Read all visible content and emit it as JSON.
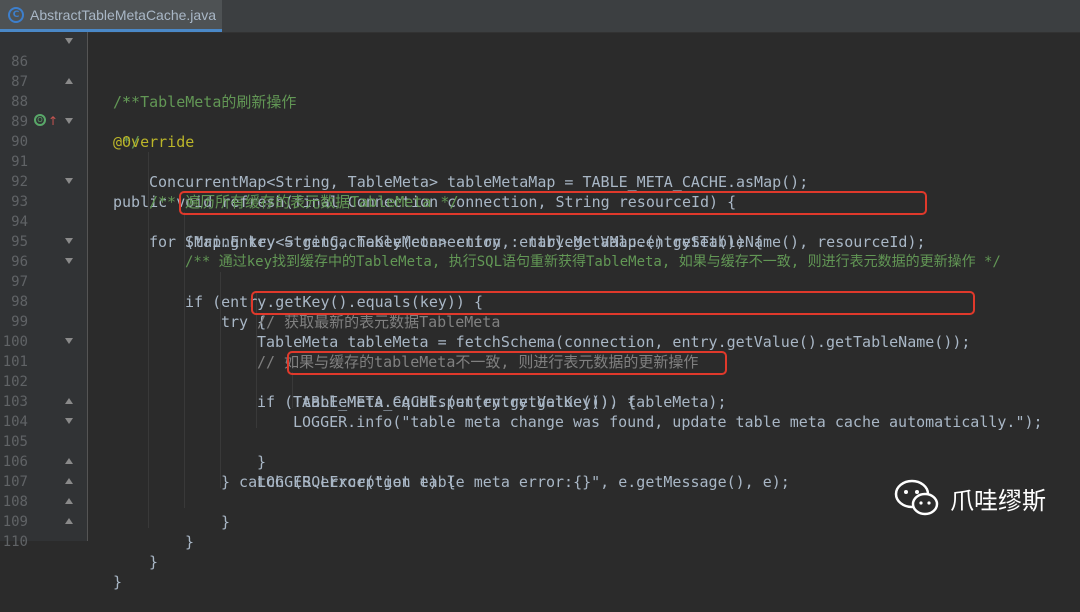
{
  "tab": {
    "label": "AbstractTableMetaCache.java",
    "icon": "java-class-icon"
  },
  "lines": [
    {
      "n": "86",
      "c": "/**"
    },
    {
      "n": "87",
      "c": " * TableMeta的刷新操作"
    },
    {
      "n": "88",
      "c": " */"
    },
    {
      "n": "89",
      "c": "@Override"
    },
    {
      "n": "90",
      "c": "public void refresh(final Connection connection, String resourceId) {"
    },
    {
      "n": "91",
      "c": "ConcurrentMap<String, TableMeta> tableMetaMap = TABLE_META_CACHE.asMap();"
    },
    {
      "n": "92",
      "c": "/** 遍历所有缓存的表元数据TableMeta */"
    },
    {
      "n": "93",
      "c": "for (Map.Entry<String, TableMeta> entry : tableMetaMap.entrySet()) {"
    },
    {
      "n": "94",
      "c": "String key = getCacheKey(connection, entry.getValue().getTableName(), resourceId);"
    },
    {
      "n": "95",
      "c": "/** 通过key找到缓存中的TableMeta, 执行SQL语句重新获得TableMeta, 如果与缓存不一致, 则进行表元数据的更新操作 */"
    },
    {
      "n": "96",
      "c": "if (entry.getKey().equals(key)) {"
    },
    {
      "n": "97",
      "c": "try {"
    },
    {
      "n": "98",
      "c": "// 获取最新的表元数据TableMeta"
    },
    {
      "n": "99",
      "c": "TableMeta tableMeta = fetchSchema(connection, entry.getValue().getTableName());"
    },
    {
      "n": "100",
      "c": "// 如果与缓存的tableMeta不一致, 则进行表元数据的更新操作"
    },
    {
      "n": "101",
      "c": "if (!tableMeta.equals(entry.getValue())) {"
    },
    {
      "n": "102",
      "c": "TABLE_META_CACHE.put(entry.getKey(), tableMeta);"
    },
    {
      "n": "103",
      "c": "LOGGER.info(\"table meta change was found, update table meta cache automatically.\");"
    },
    {
      "n": "104",
      "c": "}"
    },
    {
      "n": "105",
      "c": "} catch (SQLException e) {"
    },
    {
      "n": "106",
      "c": "LOGGER.error(\"get table meta error:{}\", e.getMessage(), e);"
    },
    {
      "n": "107",
      "c": "}"
    },
    {
      "n": "108",
      "c": "}"
    },
    {
      "n": "109",
      "c": "}"
    },
    {
      "n": "110",
      "c": "}"
    }
  ],
  "watermark": {
    "label": "爪哇缪斯",
    "icon": "wechat-icon"
  },
  "colors": {
    "background": "#2b2b2b",
    "keyword": "#cc7832",
    "highlight_box": "#e0392b"
  }
}
